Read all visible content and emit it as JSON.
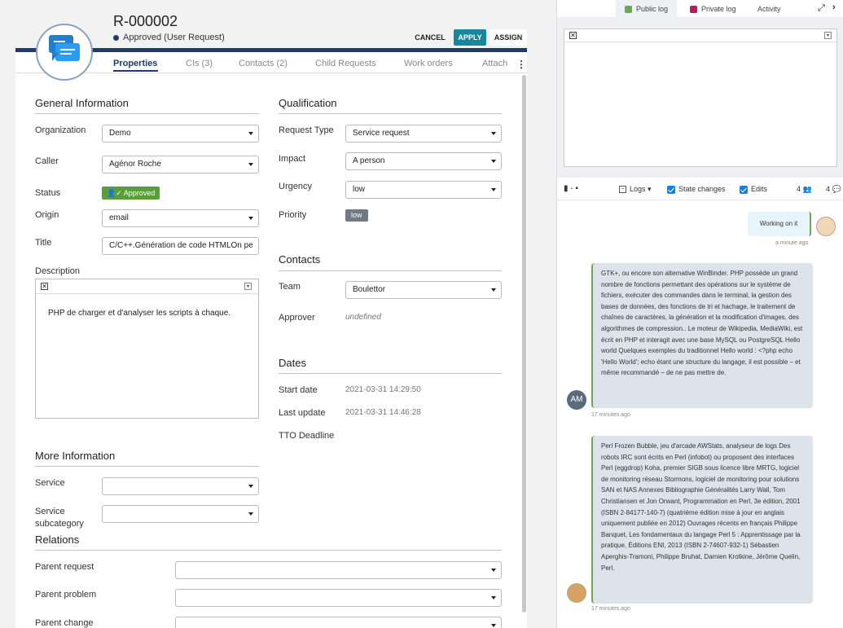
{
  "header": {
    "ref": "R-000002",
    "status": "Approved",
    "status_reason": "(User Request)",
    "cancel": "CANCEL",
    "apply": "APPLY",
    "assign": "ASSIGN"
  },
  "tabs": [
    "Properties",
    "CIs (3)",
    "Contacts (2)",
    "Child Requests",
    "Work orders",
    "Attach"
  ],
  "general": {
    "title": "General Information",
    "organization_label": "Organization",
    "organization": "Demo",
    "caller_label": "Caller",
    "caller": "Agénor Roche",
    "status_label": "Status",
    "status_badge": "Approved",
    "origin_label": "Origin",
    "origin": "email",
    "title_label": "Title",
    "title_value": "C/C++.Génération de code HTMLOn pe",
    "description_label": "Description",
    "description": "PHP de charger et d'analyser les scripts à chaque."
  },
  "qualification": {
    "title": "Qualification",
    "request_type_label": "Request Type",
    "request_type": "Service request",
    "impact_label": "Impact",
    "impact": "A person",
    "urgency_label": "Urgency",
    "urgency": "low",
    "priority_label": "Priority",
    "priority": "low"
  },
  "contacts": {
    "title": "Contacts",
    "team_label": "Team",
    "team": "Boulettor",
    "approver_label": "Approver",
    "approver": "undefined"
  },
  "dates": {
    "title": "Dates",
    "start_label": "Start date",
    "start": "2021-03-31 14:29:50",
    "update_label": "Last update",
    "update": "2021-03-31 14:46:28",
    "tto_label": "TTO Deadline"
  },
  "more": {
    "title": "More Information",
    "service_label": "Service",
    "subcat_label_1": "Service",
    "subcat_label_2": "subcategory"
  },
  "relations": {
    "title": "Relations",
    "parent_request": "Parent request",
    "parent_problem": "Parent problem",
    "parent_change": "Parent change"
  },
  "activity": {
    "public_log": "Public log",
    "private_log": "Private log",
    "activity": "Activity",
    "logs": "Logs",
    "state_changes": "State changes",
    "edits": "Edits",
    "count1": "4",
    "count2": "4",
    "colors": {
      "public": "#6aa84f",
      "private": "#c2185b"
    }
  },
  "messages": [
    {
      "text": "Working on it",
      "ago": "a minute ago"
    },
    {
      "initials": "AM",
      "text": "GTK+, ou encore son alternative WinBinder. PHP possède un grand nombre de fonctions permettant des opérations sur le système de fichiers, exécuter des commandes dans le terminal, la gestion des bases de données, des fonctions de tri et hachage, le traitement de chaînes de caractères, la génération et la modification d'images, des algorithmes de compression.. Le moteur de Wikipedia, MediaWiki, est écrit en PHP et interagit avec une base MySQL ou PostgreSQL Hello world Quelques exemples du traditionnel Hello world : <?php echo 'Hello World'; echo étant une structure du langage, il est possible – et même recommandé – de ne pas mettre de.",
      "ago": "17 minutes ago"
    },
    {
      "text": "Perl Frozen Bubble, jeu d'arcade AWStats, analyseur de logs Des robots IRC sont écrits en Perl (infobot) ou proposent des interfaces Perl (eggdrop) Koha, premier SIGB sous licence libre MRTG, logiciel de monitoring réseau Stormons, logiciel de monitoring pour solutions SAN et NAS Annexes Bibliographie Généralités Larry Wall, Tom Christiansen et Jon Orwant, Programmation en Perl, 3e édition, 2001 (ISBN 2-84177-140-7) (quatrième édition mise à jour en anglais uniquement publiée en 2012) Ouvrages récents en français Philippe Banquet, Les fondamentaux du langage Perl 5 : Apprentissage par la pratique, Éditions ENI, 2013 (ISBN 2-74607-932-1) Sébastien Aperghis-Tramoni, Philippe Bruhat, Damien Krotkine, Jérôme Quelin, Perl.",
      "ago": "17 minutes ago"
    }
  ]
}
